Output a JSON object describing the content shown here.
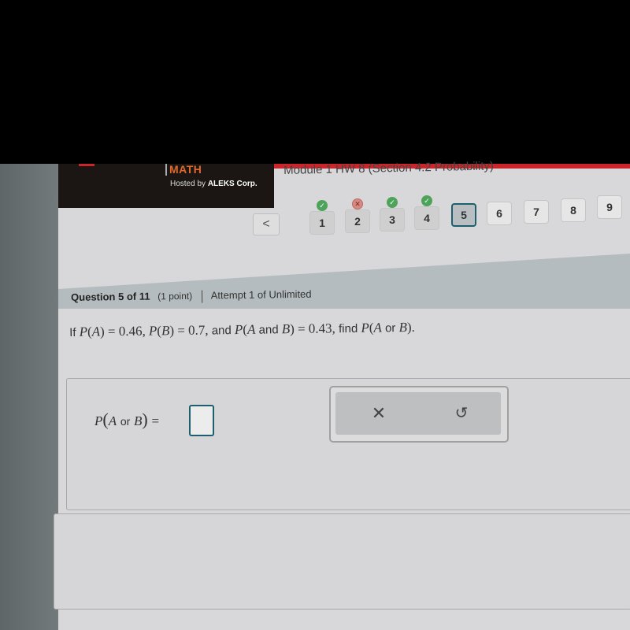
{
  "brand": {
    "product": "MATH",
    "hosted_prefix": "Hosted by",
    "hosted_company": "ALEKS Corp."
  },
  "assignment": {
    "title": "Module 1 HW 8 (Section 4.2 Probability)"
  },
  "nav": {
    "back_icon": "chevron-left-icon",
    "back_glyph": "<",
    "questions": [
      {
        "label": "1",
        "status": "correct"
      },
      {
        "label": "2",
        "status": "incorrect"
      },
      {
        "label": "3",
        "status": "correct"
      },
      {
        "label": "4",
        "status": "correct"
      },
      {
        "label": "5",
        "status": "current"
      },
      {
        "label": "6",
        "status": "unanswered"
      },
      {
        "label": "7",
        "status": "unanswered"
      },
      {
        "label": "8",
        "status": "unanswered"
      },
      {
        "label": "9",
        "status": "unanswered"
      }
    ],
    "correct_glyph": "✓",
    "incorrect_glyph": "✕"
  },
  "question_header": {
    "question": "Question 5 of 11",
    "points": "(1 point)",
    "attempt": "Attempt 1 of Unlimited"
  },
  "question": {
    "if": "If",
    "pa_label": "P",
    "a": "A",
    "b": "B",
    "pa_value": "= 0.46,",
    "pb_value": "= 0.7,",
    "and_word": "and",
    "and_inner": "and",
    "pab_value": "= 0.43,",
    "find": "find",
    "or_word": "or",
    "end": "."
  },
  "answer": {
    "lhs_p": "P",
    "lhs_a": "A",
    "lhs_or": "or",
    "lhs_b": "B",
    "equals": "=",
    "value": ""
  },
  "tools": {
    "clear_glyph": "✕",
    "undo_glyph": "↺"
  },
  "colors": {
    "accent": "#1e5f6e",
    "correct": "#4ea35a",
    "incorrect": "#d78a82",
    "brand_orange": "#e0682a",
    "brand_red": "#c8262a"
  }
}
